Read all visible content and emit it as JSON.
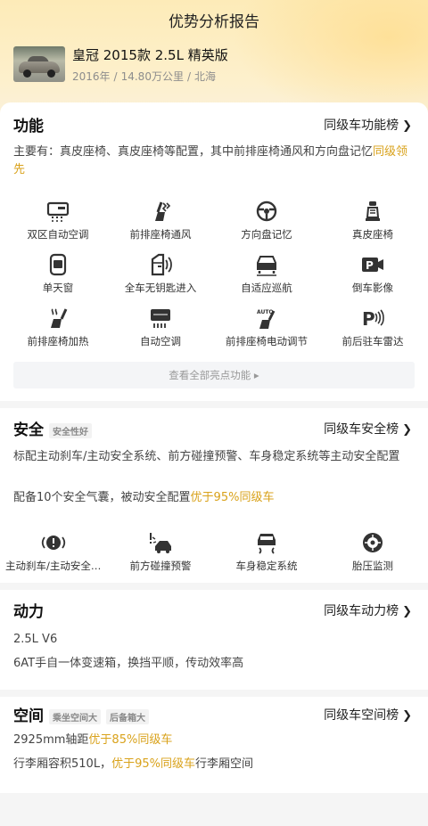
{
  "page_title": "优势分析报告",
  "car": {
    "name": "皇冠 2015款 2.5L 精英版",
    "year": "2016年",
    "mileage": "14.80万公里",
    "city": "北海"
  },
  "features": {
    "title": "功能",
    "link": "同级车功能榜",
    "summary_prefix": "主要有：真皮座椅、真皮座椅等配置，其中前排座椅通风和方向盘记忆",
    "summary_highlight": "同级领先",
    "items": [
      {
        "label": "双区自动空调",
        "icon": "dual-zone-ac-icon"
      },
      {
        "label": "前排座椅通风",
        "icon": "seat-ventilation-icon"
      },
      {
        "label": "方向盘记忆",
        "icon": "steering-memory-icon"
      },
      {
        "label": "真皮座椅",
        "icon": "leather-seat-icon"
      },
      {
        "label": "单天窗",
        "icon": "sunroof-icon"
      },
      {
        "label": "全车无钥匙进入",
        "icon": "keyless-entry-icon"
      },
      {
        "label": "自适应巡航",
        "icon": "adaptive-cruise-icon"
      },
      {
        "label": "倒车影像",
        "icon": "reverse-camera-icon"
      },
      {
        "label": "前排座椅加热",
        "icon": "seat-heating-icon"
      },
      {
        "label": "自动空调",
        "icon": "auto-ac-icon"
      },
      {
        "label": "前排座椅电动调节",
        "icon": "power-seat-icon"
      },
      {
        "label": "前后驻车雷达",
        "icon": "parking-radar-icon"
      }
    ],
    "more_label": "查看全部亮点功能 ▸"
  },
  "safety": {
    "title": "安全",
    "tag": "安全性好",
    "link": "同级车安全榜",
    "line1": "标配主动刹车/主动安全系统、前方碰撞预警、车身稳定系统等主动安全配置",
    "line2_prefix": "配备10个安全气囊，被动安全配置",
    "line2_highlight": "优于95%同级车",
    "items": [
      {
        "label": "主动刹车/主动安全系统",
        "icon": "active-brake-icon"
      },
      {
        "label": "前方碰撞预警",
        "icon": "collision-warning-icon"
      },
      {
        "label": "车身稳定系统",
        "icon": "stability-control-icon"
      },
      {
        "label": "胎压监测",
        "icon": "tire-pressure-icon"
      }
    ]
  },
  "power": {
    "title": "动力",
    "link": "同级车动力榜",
    "engine": "2.5L V6",
    "transmission": "6AT手自一体变速箱，换挡平顺，传动效率高"
  },
  "space": {
    "title": "空间",
    "tags": [
      "乘坐空间大",
      "后备箱大"
    ],
    "link": "同级车空间榜",
    "line1_prefix": "2925mm轴距",
    "line1_highlight": "优于85%同级车",
    "line2_prefix": "行李厢容积510L，",
    "line2_highlight": "优于95%同级车",
    "line2_suffix": "行李厢空间"
  },
  "colors": {
    "accent": "#d9a21b",
    "hero": "#fdebb8"
  }
}
